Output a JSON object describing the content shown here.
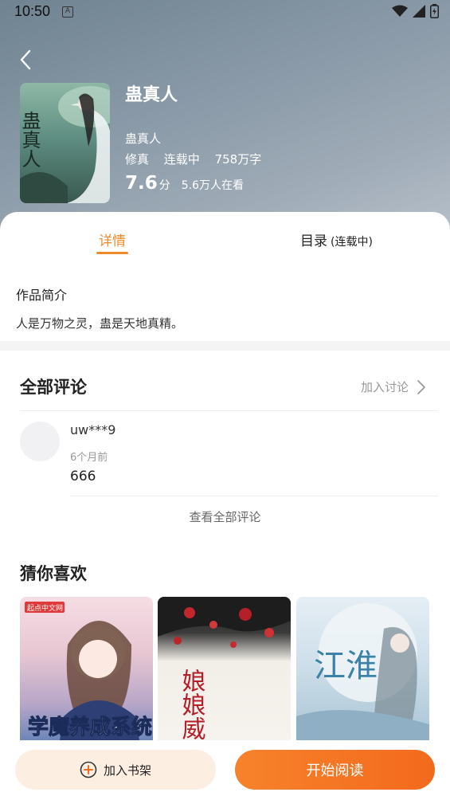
{
  "status_bar": {
    "time": "10:50",
    "notif_icon_letter": "A"
  },
  "book": {
    "title": "蛊真人",
    "author": "蛊真人",
    "category": "修真",
    "status": "连载中",
    "word_count": "758万字",
    "rating": "7.6",
    "rating_unit": "分",
    "readers": "5.6万人在看",
    "cover_text": "蛊真人"
  },
  "tabs": {
    "detail": "详情",
    "toc": "目录",
    "toc_sub": "(连载中)"
  },
  "intro": {
    "title": "作品简介",
    "text": "人是万物之灵，蛊是天地真精。"
  },
  "comments": {
    "title": "全部评论",
    "join_label": "加入讨论",
    "view_all": "查看全部评论",
    "items": [
      {
        "user": "uw***9",
        "time": "6个月前",
        "text": "666"
      }
    ]
  },
  "recommend": {
    "title": "猜你喜欢",
    "books": [
      {
        "cover_text": "学魔养成系统",
        "badge": "起点中文网"
      },
      {
        "cover_text": "娘娘威武"
      },
      {
        "cover_text": "江淮"
      }
    ]
  },
  "actions": {
    "add_shelf": "加入书架",
    "start_read": "开始阅读"
  },
  "colors": {
    "accent": "#f08a2a",
    "read_button": "#f36a1c",
    "shelf_button_bg": "#fdeee2"
  }
}
